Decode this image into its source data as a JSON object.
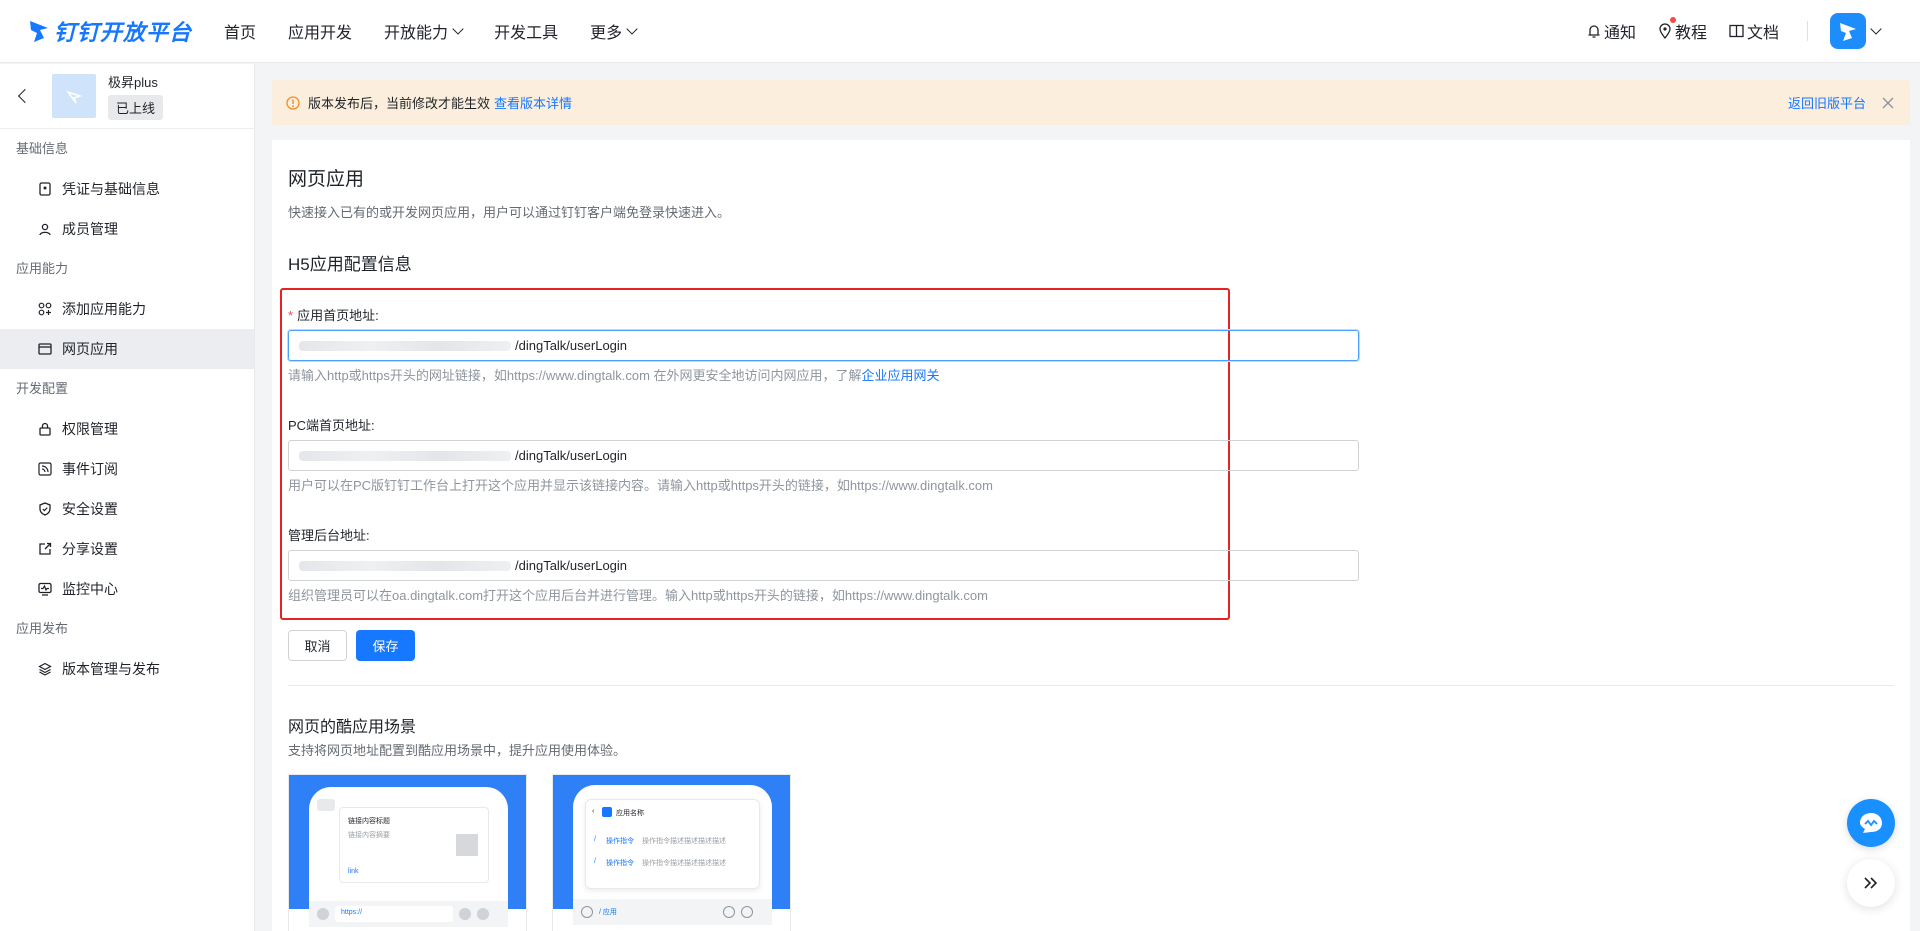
{
  "brand": {
    "name": "钉钉开放平台"
  },
  "nav": {
    "items": [
      {
        "label": "首页",
        "has_dropdown": false
      },
      {
        "label": "应用开发",
        "has_dropdown": false
      },
      {
        "label": "开放能力",
        "has_dropdown": true
      },
      {
        "label": "开发工具",
        "has_dropdown": false
      },
      {
        "label": "更多",
        "has_dropdown": true
      }
    ],
    "right": {
      "notify": "通知",
      "tutorial": "教程",
      "docs": "文档"
    }
  },
  "app": {
    "name": "极昇plus",
    "status": "已上线"
  },
  "sidebar": {
    "groups": [
      {
        "title": "基础信息",
        "items": [
          {
            "label": "凭证与基础信息",
            "icon": "credential-icon"
          },
          {
            "label": "成员管理",
            "icon": "user-icon"
          }
        ]
      },
      {
        "title": "应用能力",
        "items": [
          {
            "label": "添加应用能力",
            "icon": "apps-add-icon"
          },
          {
            "label": "网页应用",
            "icon": "window-icon",
            "active": true
          }
        ]
      },
      {
        "title": "开发配置",
        "items": [
          {
            "label": "权限管理",
            "icon": "lock-icon"
          },
          {
            "label": "事件订阅",
            "icon": "rss-icon"
          },
          {
            "label": "安全设置",
            "icon": "shield-icon"
          },
          {
            "label": "分享设置",
            "icon": "share-icon"
          },
          {
            "label": "监控中心",
            "icon": "monitor-icon"
          }
        ]
      },
      {
        "title": "应用发布",
        "items": [
          {
            "label": "版本管理与发布",
            "icon": "layers-icon"
          }
        ]
      }
    ]
  },
  "notice": {
    "text": "版本发布后，当前修改才能生效",
    "link": "查看版本详情",
    "right_link": "返回旧版平台"
  },
  "main": {
    "title": "网页应用",
    "desc": "快速接入已有的或开发网页应用，用户可以通过钉钉客户端免登录快速进入。",
    "section": "H5应用配置信息",
    "fields": {
      "home": {
        "label": "应用首页地址:",
        "value": "/dingTalk/userLogin",
        "help": "请输入http或https开头的网址链接，如https://www.dingtalk.com 在外网更安全地访问内网应用，了解",
        "help_link": "企业应用网关"
      },
      "pc": {
        "label": "PC端首页地址:",
        "value": "/dingTalk/userLogin",
        "help": "用户可以在PC版钉钉工作台上打开这个应用并显示该链接内容。请输入http或https开头的链接，如https://www.dingtalk.com"
      },
      "admin": {
        "label": "管理后台地址:",
        "value": "/dingTalk/userLogin",
        "help": "组织管理员可以在oa.dingtalk.com打开这个应用后台并进行管理。输入http或https开头的链接，如https://www.dingtalk.com"
      }
    },
    "cancel": "取消",
    "save": "保存",
    "scene": {
      "title": "网页的酷应用场景",
      "desc": "支持将网页地址配置到酷应用场景中，提升应用使用体验。",
      "card1": {
        "link_title": "链接内容标题",
        "link_sub": "链接内容摘要",
        "link_tag": "link",
        "url": "https://"
      },
      "card2": {
        "app_name": "应用名称",
        "cmd1": "操作指令",
        "cmd2": "操作指令",
        "cmd_desc": "操作指令描述描述描述描述",
        "bar": "/ 应用"
      }
    }
  },
  "colors": {
    "accent": "#1677ff",
    "highlight": "#e52320",
    "notice_bg": "#fbeedc"
  }
}
